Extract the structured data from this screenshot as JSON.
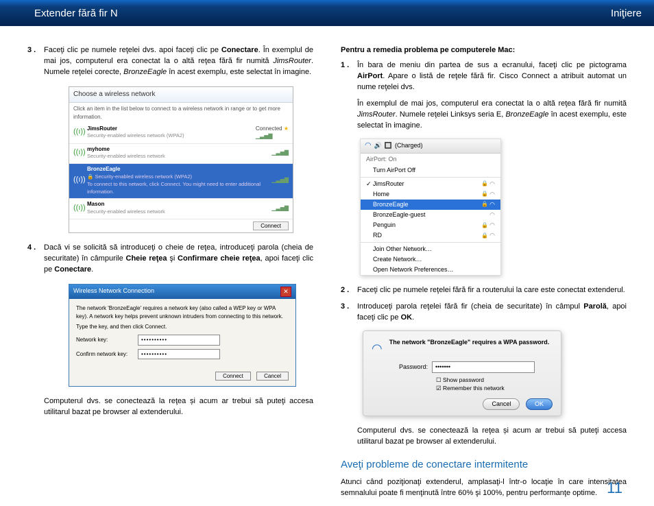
{
  "header": {
    "left": "Extender fără fir N",
    "right": "Iniţiere"
  },
  "left": {
    "step3": {
      "num": "3 .",
      "t1": "Faceţi clic pe numele reţelei dvs. apoi faceţi clic pe ",
      "b1": "Conectare",
      "t2": ". În exemplul de mai jos, computerul era conectat la o altă reţea fără fir numită ",
      "i1": "JimsRouter",
      "t3": ". Numele reţelei corecte, ",
      "i2": "BronzeEagle",
      "t4": " în acest exemplu, este selectat în imagine."
    },
    "step4": {
      "num": "4 .",
      "t1": "Dacă vi se solicită să introduceţi o cheie de reţea, introduceţi parola (cheia de securitate) în câmpurile ",
      "b1": "Cheie reţea",
      "t2": " şi ",
      "b2": "Confirmare cheie reţea",
      "t3": ", apoi faceţi clic pe ",
      "b3": "Conectare",
      "t4": "."
    },
    "closing": "Computerul dvs. se conectează la reţea și acum ar trebui să puteţi accesa utilitarul bazat pe browser al extenderului."
  },
  "fig1": {
    "title": "Choose a wireless network",
    "sub": "Click an item in the list below to connect to a wireless network in range or to get more information.",
    "r1n": "JimsRouter",
    "r1c": "Connected",
    "r1s": "Security-enabled wireless network (WPA2)",
    "r2n": "myhome",
    "r2s": "Security-enabled wireless network",
    "r3n": "BronzeEagle",
    "r3s": "Security-enabled wireless network (WPA2)",
    "r3t": "To connect to this network, click Connect. You might need to enter additional information.",
    "r4n": "Mason",
    "r4s": "Security-enabled wireless network",
    "btn": "Connect"
  },
  "fig2": {
    "title": "Wireless Network Connection",
    "msg": "The network 'BronzeEagle' requires a network key (also called a WEP key or WPA key). A network key helps prevent unknown intruders from connecting to this network.",
    "hint": "Type the key, and then click Connect.",
    "l1": "Network key:",
    "l2": "Confirm network key:",
    "dots": "••••••••••",
    "connect": "Connect",
    "cancel": "Cancel"
  },
  "right": {
    "subhead": "Pentru a remedia problema pe computerele Mac:",
    "step1": {
      "num": "1 .",
      "t1": "În bara de meniu din partea de sus a ecranului, faceţi clic pe pictograma ",
      "b1": "AirPort",
      "t2": ". Apare o listă de reţele fără fir. Cisco Connect a atribuit automat un nume reţelei dvs."
    },
    "ex": {
      "t1": "În exemplul de mai jos, computerul era conectat la o altă reţea fără fir numită ",
      "i1": "JimsRouter",
      "t2": ". Numele reţelei Linksys seria E, ",
      "i2": "BronzeEagle",
      "t3": " în acest exemplu, este selectat în imagine."
    },
    "step2": {
      "num": "2 .",
      "t": "Faceţi clic pe numele reţelei fără fir a routerului la care este conectat extenderul."
    },
    "step3": {
      "num": "3 .",
      "t1": "Introduceţi parola reţelei fără fir (cheia de securitate) în câmpul ",
      "b1": "Parolă",
      "t2": ", apoi faceţi clic pe ",
      "b2": "OK",
      "t3": "."
    },
    "closing": "Computerul dvs. se conectează la reţea și acum ar trebui să puteţi accesa utilitarul bazat pe browser al extenderului.",
    "h2": "Aveţi probleme de conectare intermitente",
    "intermit": "Atunci când poziţionaţi extenderul, amplasaţi-l într-o locaţie în care intensitatea semnalului poate fi menţinută între 60% şi 100%, pentru performanţe optime."
  },
  "fig3": {
    "menubar": "(Charged)",
    "on": "AirPort: On",
    "off": "Turn AirPort Off",
    "n1": "JimsRouter",
    "n2": "Home",
    "n3": "BronzeEagle",
    "n4": "BronzeEagle-guest",
    "n5": "Penguin",
    "n6": "RD",
    "j1": "Join Other Network…",
    "j2": "Create Network…",
    "j3": "Open Network Preferences…"
  },
  "fig4": {
    "msg": "The network \"BronzeEagle\" requires a WPA password.",
    "lbl": "Password:",
    "dots": "•••••••",
    "cb1": "Show password",
    "cb2": "Remember this network",
    "cancel": "Cancel",
    "ok": "OK"
  },
  "pagenum": "11"
}
